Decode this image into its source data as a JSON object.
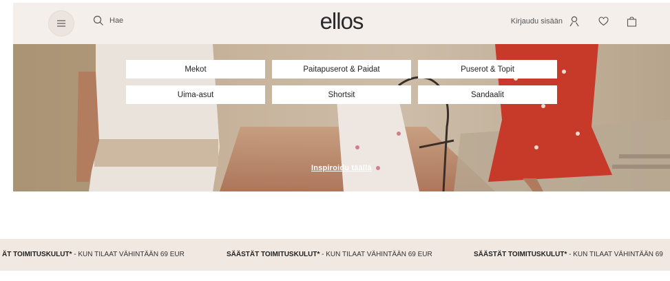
{
  "header": {
    "search_placeholder": "Hae",
    "logo": "ellos",
    "login_label": "Kirjaudu sisään"
  },
  "categories": [
    "Mekot",
    "Paitapuserot & Paidat",
    "Puserot & Topit",
    "Uima-asut",
    "Shortsit",
    "Sandaalit"
  ],
  "hero": {
    "inspire_link": "Inspiroidu täällä"
  },
  "promo": {
    "items": [
      {
        "bold": "ÄT TOIMITUSKULUT*",
        "rest": " - KUN TILAAT VÄHINTÄÄN 69 EUR"
      },
      {
        "bold": "SÄÄSTÄT TOIMITUSKULUT*",
        "rest": " - KUN TILAAT VÄHINTÄÄN 69 EUR"
      },
      {
        "bold": "SÄÄSTÄT TOIMITUSKULUT*",
        "rest": " - KUN TILAAT VÄHINTÄÄN 69"
      }
    ]
  },
  "icons": {
    "menu": "menu-icon",
    "search": "search-icon",
    "user": "user-icon",
    "heart": "heart-icon",
    "bag": "bag-icon"
  }
}
